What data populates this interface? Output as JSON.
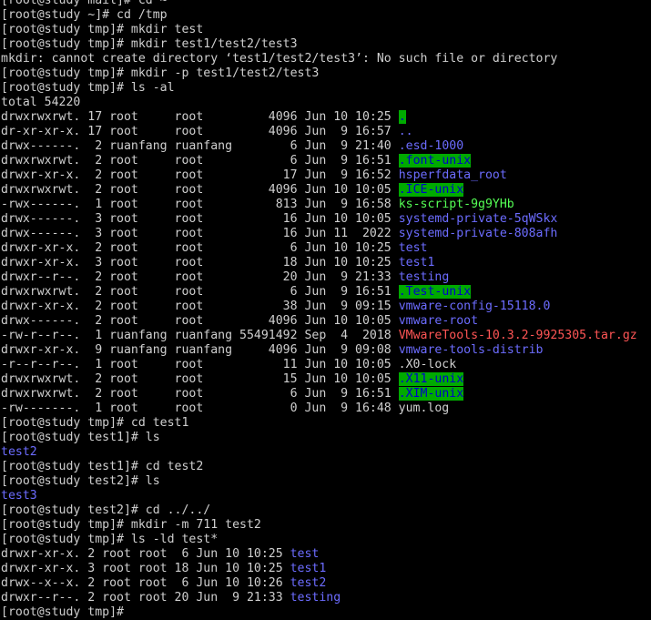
{
  "terminal": {
    "lines": [
      [
        {
          "t": "[root@study mail]# cd ~"
        }
      ],
      [
        {
          "t": "[root@study ~]# cd /tmp"
        }
      ],
      [
        {
          "t": "[root@study tmp]# mkdir test"
        }
      ],
      [
        {
          "t": "[root@study tmp]# mkdir test1/test2/test3"
        }
      ],
      [
        {
          "t": "mkdir: cannot create directory ‘test1/test2/test3’: No such file or directory"
        }
      ],
      [
        {
          "t": "[root@study tmp]# mkdir -p test1/test2/test3"
        }
      ],
      [
        {
          "t": "[root@study tmp]# ls -al"
        }
      ],
      [
        {
          "t": "total 54220"
        }
      ],
      [
        {
          "t": "drwxrwxrwt. 17 root     root         4096 Jun 10 10:25 "
        },
        {
          "t": ".",
          "s": "hl"
        }
      ],
      [
        {
          "t": "dr-xr-xr-x. 17 root     root         4096 Jun  9 16:57 "
        },
        {
          "t": "..",
          "s": "dir"
        }
      ],
      [
        {
          "t": "drwx------.  2 ruanfang ruanfang        6 Jun  9 21:40 "
        },
        {
          "t": ".esd-1000",
          "s": "dir"
        }
      ],
      [
        {
          "t": "drwxrwxrwt.  2 root     root            6 Jun  9 16:51 "
        },
        {
          "t": ".font-unix",
          "s": "hl"
        }
      ],
      [
        {
          "t": "drwxr-xr-x.  2 root     root           17 Jun  9 16:52 "
        },
        {
          "t": "hsperfdata_root",
          "s": "dir"
        }
      ],
      [
        {
          "t": "drwxrwxrwt.  2 root     root         4096 Jun 10 10:05 "
        },
        {
          "t": ".ICE-unix",
          "s": "hl"
        }
      ],
      [
        {
          "t": "-rwx------.  1 root     root          813 Jun  9 16:58 "
        },
        {
          "t": "ks-script-9g9YHb",
          "s": "exe"
        }
      ],
      [
        {
          "t": "drwx------.  3 root     root           16 Jun 10 10:05 "
        },
        {
          "t": "systemd-private-5qWSkx",
          "s": "dir"
        }
      ],
      [
        {
          "t": "drwx------.  3 root     root           16 Jun 11  2022 "
        },
        {
          "t": "systemd-private-808afh",
          "s": "dir"
        }
      ],
      [
        {
          "t": "drwxr-xr-x.  2 root     root            6 Jun 10 10:25 "
        },
        {
          "t": "test",
          "s": "dir"
        }
      ],
      [
        {
          "t": "drwxr-xr-x.  3 root     root           18 Jun 10 10:25 "
        },
        {
          "t": "test1",
          "s": "dir"
        }
      ],
      [
        {
          "t": "drwxr--r--.  2 root     root           20 Jun  9 21:33 "
        },
        {
          "t": "testing",
          "s": "dir"
        }
      ],
      [
        {
          "t": "drwxrwxrwt.  2 root     root            6 Jun  9 16:51 "
        },
        {
          "t": ".Test-unix",
          "s": "hl"
        }
      ],
      [
        {
          "t": "drwxr-xr-x.  2 root     root           38 Jun  9 09:15 "
        },
        {
          "t": "vmware-config-15118.0",
          "s": "dir"
        }
      ],
      [
        {
          "t": "drwx------.  2 root     root         4096 Jun 10 10:05 "
        },
        {
          "t": "vmware-root",
          "s": "dir"
        }
      ],
      [
        {
          "t": "-rw-r--r--.  1 ruanfang ruanfang 55491492 Sep  4  2018 "
        },
        {
          "t": "VMwareTools-10.3.2-9925305.tar.gz",
          "s": "arc"
        }
      ],
      [
        {
          "t": "drwxr-xr-x.  9 ruanfang ruanfang     4096 Jun  9 09:08 "
        },
        {
          "t": "vmware-tools-distrib",
          "s": "dir"
        }
      ],
      [
        {
          "t": "-r--r--r--.  1 root     root           11 Jun 10 10:05 .X0-lock"
        }
      ],
      [
        {
          "t": "drwxrwxrwt.  2 root     root           15 Jun 10 10:05 "
        },
        {
          "t": ".X11-unix",
          "s": "hl"
        }
      ],
      [
        {
          "t": "drwxrwxrwt.  2 root     root            6 Jun  9 16:51 "
        },
        {
          "t": ".XIM-unix",
          "s": "hl"
        }
      ],
      [
        {
          "t": "-rw-------.  1 root     root            0 Jun  9 16:48 yum.log"
        }
      ],
      [
        {
          "t": "[root@study tmp]# cd test1"
        }
      ],
      [
        {
          "t": "[root@study test1]# ls"
        }
      ],
      [
        {
          "t": "test2",
          "s": "dir"
        }
      ],
      [
        {
          "t": "[root@study test1]# cd test2"
        }
      ],
      [
        {
          "t": "[root@study test2]# ls"
        }
      ],
      [
        {
          "t": "test3",
          "s": "dir"
        }
      ],
      [
        {
          "t": "[root@study test2]# cd ../../"
        }
      ],
      [
        {
          "t": "[root@study tmp]# mkdir -m 711 test2"
        }
      ],
      [
        {
          "t": "[root@study tmp]# ls -ld test*"
        }
      ],
      [
        {
          "t": "drwxr-xr-x. 2 root root  6 Jun 10 10:25 "
        },
        {
          "t": "test",
          "s": "dir"
        }
      ],
      [
        {
          "t": "drwxr-xr-x. 3 root root 18 Jun 10 10:25 "
        },
        {
          "t": "test1",
          "s": "dir"
        }
      ],
      [
        {
          "t": "drwx--x--x. 2 root root  6 Jun 10 10:26 "
        },
        {
          "t": "test2",
          "s": "dir"
        }
      ],
      [
        {
          "t": "drwxr--r--. 2 root root 20 Jun  9 21:33 "
        },
        {
          "t": "testing",
          "s": "dir"
        }
      ],
      [
        {
          "t": "[root@study tmp]# "
        }
      ]
    ]
  },
  "colors": {
    "background": "#000000",
    "text": "#cfcfcf",
    "directory": "#6c6cff",
    "executable": "#55ff55",
    "archive": "#ff5555",
    "sticky_bg": "#00aa00",
    "sticky_fg": "#0000cc"
  }
}
